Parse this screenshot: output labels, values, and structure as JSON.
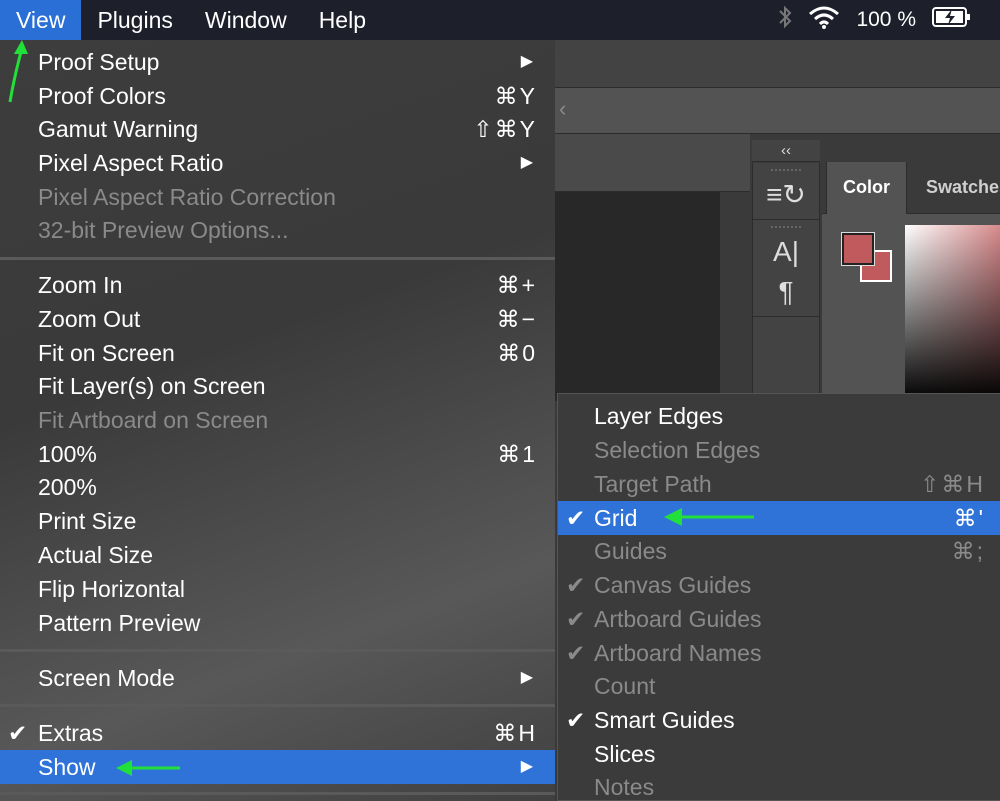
{
  "menubar": {
    "items": [
      "View",
      "Plugins",
      "Window",
      "Help"
    ],
    "battery": "100 %"
  },
  "panel": {
    "collapse": "‹‹",
    "tab_color": "Color",
    "tab_swatches": "Swatches",
    "swatch_color": "#c05a5d",
    "tools": [
      "≡↻",
      "A|",
      "¶"
    ]
  },
  "view_menu": {
    "items": [
      {
        "label": "Proof Setup",
        "shortcut": "",
        "submenu": true,
        "disabled": false
      },
      {
        "label": "Proof Colors",
        "shortcut": "⌘Y",
        "disabled": false
      },
      {
        "label": "Gamut Warning",
        "shortcut": "⇧⌘Y",
        "disabled": false
      },
      {
        "label": "Pixel Aspect Ratio",
        "shortcut": "",
        "submenu": true,
        "disabled": false
      },
      {
        "label": "Pixel Aspect Ratio Correction",
        "shortcut": "",
        "disabled": true
      },
      {
        "label": "32-bit Preview Options...",
        "shortcut": "",
        "disabled": true
      },
      {
        "label": "Zoom In",
        "shortcut": "⌘+",
        "disabled": false
      },
      {
        "label": "Zoom Out",
        "shortcut": "⌘−",
        "disabled": false
      },
      {
        "label": "Fit on Screen",
        "shortcut": "⌘0",
        "disabled": false
      },
      {
        "label": "Fit Layer(s) on Screen",
        "shortcut": "",
        "disabled": false
      },
      {
        "label": "Fit Artboard on Screen",
        "shortcut": "",
        "disabled": true
      },
      {
        "label": "100%",
        "shortcut": "⌘1",
        "disabled": false
      },
      {
        "label": "200%",
        "shortcut": "",
        "disabled": false
      },
      {
        "label": "Print Size",
        "shortcut": "",
        "disabled": false
      },
      {
        "label": "Actual Size",
        "shortcut": "",
        "disabled": false
      },
      {
        "label": "Flip Horizontal",
        "shortcut": "",
        "disabled": false
      },
      {
        "label": "Pattern Preview",
        "shortcut": "",
        "disabled": false
      },
      {
        "label": "Screen Mode",
        "shortcut": "",
        "submenu": true,
        "disabled": false
      },
      {
        "label": "Extras",
        "shortcut": "⌘H",
        "checked": true,
        "disabled": false
      },
      {
        "label": "Show",
        "shortcut": "",
        "submenu": true,
        "highlighted": true,
        "disabled": false
      }
    ]
  },
  "show_menu": {
    "items": [
      {
        "label": "Layer Edges",
        "shortcut": "",
        "disabled": false
      },
      {
        "label": "Selection Edges",
        "shortcut": "",
        "disabled": true
      },
      {
        "label": "Target Path",
        "shortcut": "⇧⌘H",
        "disabled": true
      },
      {
        "label": "Grid",
        "shortcut": "⌘'",
        "checked": true,
        "highlighted": true,
        "disabled": false
      },
      {
        "label": "Guides",
        "shortcut": "⌘;",
        "disabled": true
      },
      {
        "label": "Canvas Guides",
        "shortcut": "",
        "checked": true,
        "disabled": true
      },
      {
        "label": "Artboard Guides",
        "shortcut": "",
        "checked": true,
        "disabled": true
      },
      {
        "label": "Artboard Names",
        "shortcut": "",
        "checked": true,
        "disabled": true
      },
      {
        "label": "Count",
        "shortcut": "",
        "disabled": true
      },
      {
        "label": "Smart Guides",
        "shortcut": "",
        "checked": true,
        "disabled": false
      },
      {
        "label": "Slices",
        "shortcut": "",
        "disabled": false
      },
      {
        "label": "Notes",
        "shortcut": "",
        "disabled": true
      }
    ]
  },
  "symbols": {
    "check": "✔",
    "arrow": "▶"
  },
  "accents": {
    "highlight": "#2f73d9",
    "annotation_arrow": "#22e03a"
  }
}
